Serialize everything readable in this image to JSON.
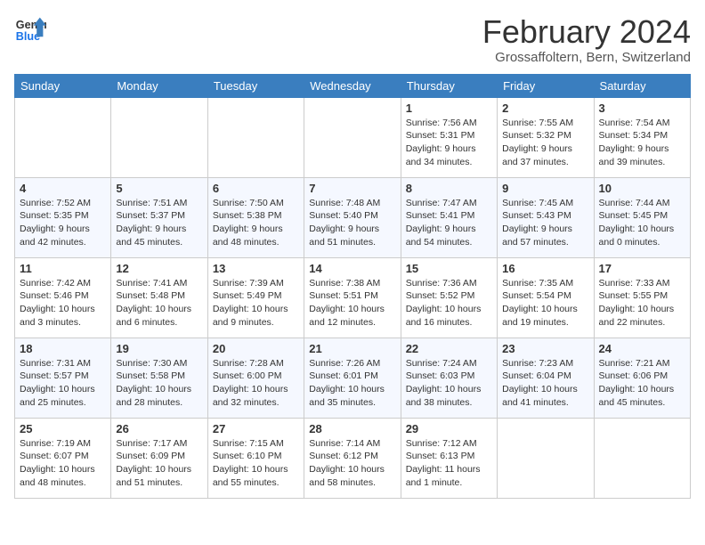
{
  "logo": {
    "line1": "General",
    "line2": "Blue"
  },
  "title": "February 2024",
  "location": "Grossaffoltern, Bern, Switzerland",
  "weekdays": [
    "Sunday",
    "Monday",
    "Tuesday",
    "Wednesday",
    "Thursday",
    "Friday",
    "Saturday"
  ],
  "weeks": [
    [
      {
        "day": "",
        "sunrise": "",
        "sunset": "",
        "daylight": ""
      },
      {
        "day": "",
        "sunrise": "",
        "sunset": "",
        "daylight": ""
      },
      {
        "day": "",
        "sunrise": "",
        "sunset": "",
        "daylight": ""
      },
      {
        "day": "",
        "sunrise": "",
        "sunset": "",
        "daylight": ""
      },
      {
        "day": "1",
        "sunrise": "Sunrise: 7:56 AM",
        "sunset": "Sunset: 5:31 PM",
        "daylight": "Daylight: 9 hours and 34 minutes."
      },
      {
        "day": "2",
        "sunrise": "Sunrise: 7:55 AM",
        "sunset": "Sunset: 5:32 PM",
        "daylight": "Daylight: 9 hours and 37 minutes."
      },
      {
        "day": "3",
        "sunrise": "Sunrise: 7:54 AM",
        "sunset": "Sunset: 5:34 PM",
        "daylight": "Daylight: 9 hours and 39 minutes."
      }
    ],
    [
      {
        "day": "4",
        "sunrise": "Sunrise: 7:52 AM",
        "sunset": "Sunset: 5:35 PM",
        "daylight": "Daylight: 9 hours and 42 minutes."
      },
      {
        "day": "5",
        "sunrise": "Sunrise: 7:51 AM",
        "sunset": "Sunset: 5:37 PM",
        "daylight": "Daylight: 9 hours and 45 minutes."
      },
      {
        "day": "6",
        "sunrise": "Sunrise: 7:50 AM",
        "sunset": "Sunset: 5:38 PM",
        "daylight": "Daylight: 9 hours and 48 minutes."
      },
      {
        "day": "7",
        "sunrise": "Sunrise: 7:48 AM",
        "sunset": "Sunset: 5:40 PM",
        "daylight": "Daylight: 9 hours and 51 minutes."
      },
      {
        "day": "8",
        "sunrise": "Sunrise: 7:47 AM",
        "sunset": "Sunset: 5:41 PM",
        "daylight": "Daylight: 9 hours and 54 minutes."
      },
      {
        "day": "9",
        "sunrise": "Sunrise: 7:45 AM",
        "sunset": "Sunset: 5:43 PM",
        "daylight": "Daylight: 9 hours and 57 minutes."
      },
      {
        "day": "10",
        "sunrise": "Sunrise: 7:44 AM",
        "sunset": "Sunset: 5:45 PM",
        "daylight": "Daylight: 10 hours and 0 minutes."
      }
    ],
    [
      {
        "day": "11",
        "sunrise": "Sunrise: 7:42 AM",
        "sunset": "Sunset: 5:46 PM",
        "daylight": "Daylight: 10 hours and 3 minutes."
      },
      {
        "day": "12",
        "sunrise": "Sunrise: 7:41 AM",
        "sunset": "Sunset: 5:48 PM",
        "daylight": "Daylight: 10 hours and 6 minutes."
      },
      {
        "day": "13",
        "sunrise": "Sunrise: 7:39 AM",
        "sunset": "Sunset: 5:49 PM",
        "daylight": "Daylight: 10 hours and 9 minutes."
      },
      {
        "day": "14",
        "sunrise": "Sunrise: 7:38 AM",
        "sunset": "Sunset: 5:51 PM",
        "daylight": "Daylight: 10 hours and 12 minutes."
      },
      {
        "day": "15",
        "sunrise": "Sunrise: 7:36 AM",
        "sunset": "Sunset: 5:52 PM",
        "daylight": "Daylight: 10 hours and 16 minutes."
      },
      {
        "day": "16",
        "sunrise": "Sunrise: 7:35 AM",
        "sunset": "Sunset: 5:54 PM",
        "daylight": "Daylight: 10 hours and 19 minutes."
      },
      {
        "day": "17",
        "sunrise": "Sunrise: 7:33 AM",
        "sunset": "Sunset: 5:55 PM",
        "daylight": "Daylight: 10 hours and 22 minutes."
      }
    ],
    [
      {
        "day": "18",
        "sunrise": "Sunrise: 7:31 AM",
        "sunset": "Sunset: 5:57 PM",
        "daylight": "Daylight: 10 hours and 25 minutes."
      },
      {
        "day": "19",
        "sunrise": "Sunrise: 7:30 AM",
        "sunset": "Sunset: 5:58 PM",
        "daylight": "Daylight: 10 hours and 28 minutes."
      },
      {
        "day": "20",
        "sunrise": "Sunrise: 7:28 AM",
        "sunset": "Sunset: 6:00 PM",
        "daylight": "Daylight: 10 hours and 32 minutes."
      },
      {
        "day": "21",
        "sunrise": "Sunrise: 7:26 AM",
        "sunset": "Sunset: 6:01 PM",
        "daylight": "Daylight: 10 hours and 35 minutes."
      },
      {
        "day": "22",
        "sunrise": "Sunrise: 7:24 AM",
        "sunset": "Sunset: 6:03 PM",
        "daylight": "Daylight: 10 hours and 38 minutes."
      },
      {
        "day": "23",
        "sunrise": "Sunrise: 7:23 AM",
        "sunset": "Sunset: 6:04 PM",
        "daylight": "Daylight: 10 hours and 41 minutes."
      },
      {
        "day": "24",
        "sunrise": "Sunrise: 7:21 AM",
        "sunset": "Sunset: 6:06 PM",
        "daylight": "Daylight: 10 hours and 45 minutes."
      }
    ],
    [
      {
        "day": "25",
        "sunrise": "Sunrise: 7:19 AM",
        "sunset": "Sunset: 6:07 PM",
        "daylight": "Daylight: 10 hours and 48 minutes."
      },
      {
        "day": "26",
        "sunrise": "Sunrise: 7:17 AM",
        "sunset": "Sunset: 6:09 PM",
        "daylight": "Daylight: 10 hours and 51 minutes."
      },
      {
        "day": "27",
        "sunrise": "Sunrise: 7:15 AM",
        "sunset": "Sunset: 6:10 PM",
        "daylight": "Daylight: 10 hours and 55 minutes."
      },
      {
        "day": "28",
        "sunrise": "Sunrise: 7:14 AM",
        "sunset": "Sunset: 6:12 PM",
        "daylight": "Daylight: 10 hours and 58 minutes."
      },
      {
        "day": "29",
        "sunrise": "Sunrise: 7:12 AM",
        "sunset": "Sunset: 6:13 PM",
        "daylight": "Daylight: 11 hours and 1 minute."
      },
      {
        "day": "",
        "sunrise": "",
        "sunset": "",
        "daylight": ""
      },
      {
        "day": "",
        "sunrise": "",
        "sunset": "",
        "daylight": ""
      }
    ]
  ]
}
